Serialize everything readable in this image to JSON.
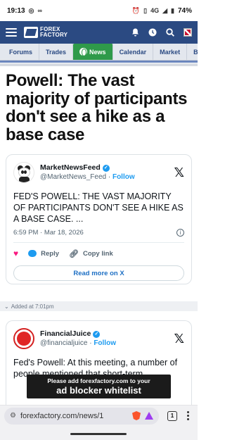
{
  "status_bar": {
    "time": "19:13",
    "network": "4G",
    "battery": "74%"
  },
  "header": {
    "logo_line1": "FOREX",
    "logo_line2": "FACTORY"
  },
  "nav": {
    "tabs": [
      "Forums",
      "Trades",
      "News",
      "Calendar",
      "Market",
      "Broke"
    ],
    "active": "News"
  },
  "article": {
    "headline": "Powell: The vast majority of participants don't see a hike as a base case"
  },
  "tweet1": {
    "name": "MarketNewsFeed",
    "handle": "@MarketNews_Feed",
    "follow": "Follow",
    "text": "FED'S POWELL: THE VAST MAJORITY OF PARTICIPANTS DON'T SEE A HIKE AS A BASE CASE. ...",
    "timestamp": "6:59 PM · Mar 18, 2026",
    "reply": "Reply",
    "copy_link": "Copy link",
    "read_more": "Read more on X"
  },
  "added_at": "Added at 7:01pm",
  "tweet2": {
    "name": "FinancialJuice",
    "handle": "@financialjuice",
    "follow": "Follow",
    "text": "Fed's Powell: At this meeting, a number of people mentioned that short-term"
  },
  "ad": {
    "line1": "Please add forexfactory.com to your",
    "line2": "ad blocker whitelist"
  },
  "browser": {
    "url": "forexfactory.com/news/1",
    "tab_count": "1"
  }
}
